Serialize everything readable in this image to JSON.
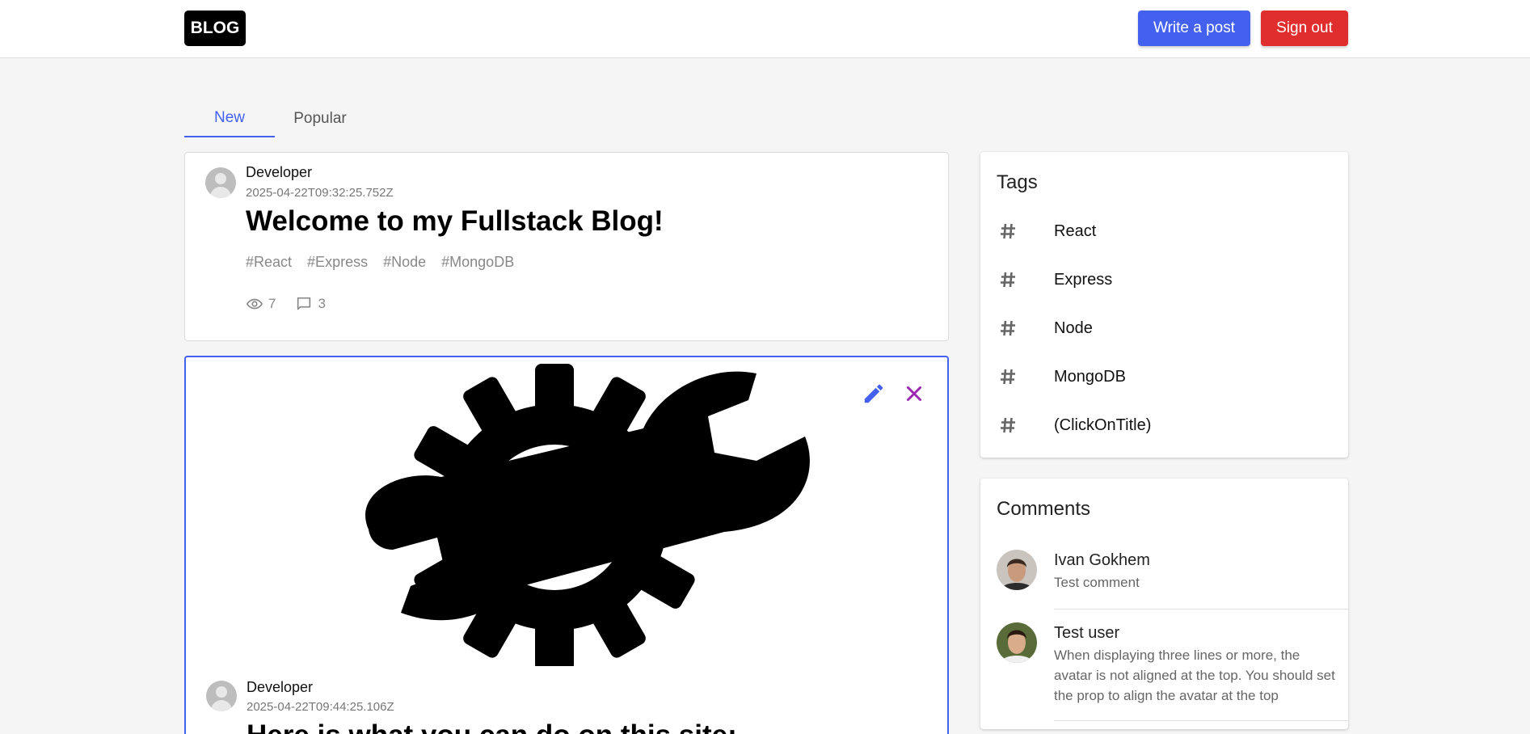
{
  "header": {
    "logo": "BLOG",
    "write_label": "Write a post",
    "signout_label": "Sign out"
  },
  "tabs": [
    {
      "label": "New",
      "active": true
    },
    {
      "label": "Popular",
      "active": false
    }
  ],
  "posts": [
    {
      "author": "Developer",
      "date": "2025-04-22T09:32:25.752Z",
      "title": "Welcome to my Fullstack Blog!",
      "tags": [
        "#React",
        "#Express",
        "#Node",
        "#MongoDB"
      ],
      "views": "7",
      "comments": "3"
    },
    {
      "author": "Developer",
      "date": "2025-04-22T09:44:25.106Z",
      "title": "Here is what you can do on this site:",
      "image": "gear-wrench-image"
    }
  ],
  "sidebar": {
    "tags_title": "Tags",
    "tags": [
      "React",
      "Express",
      "Node",
      "MongoDB",
      "(ClickOnTitle)"
    ],
    "comments_title": "Comments",
    "comments": [
      {
        "name": "Ivan Gokhem",
        "text": "Test comment"
      },
      {
        "name": "Test user",
        "text": "When displaying three lines or more, the avatar is not aligned at the top. You should set the prop to align the avatar at the top"
      }
    ]
  },
  "colors": {
    "accent": "#4361ee",
    "danger": "#e02d2d",
    "close": "#9c27b0"
  }
}
